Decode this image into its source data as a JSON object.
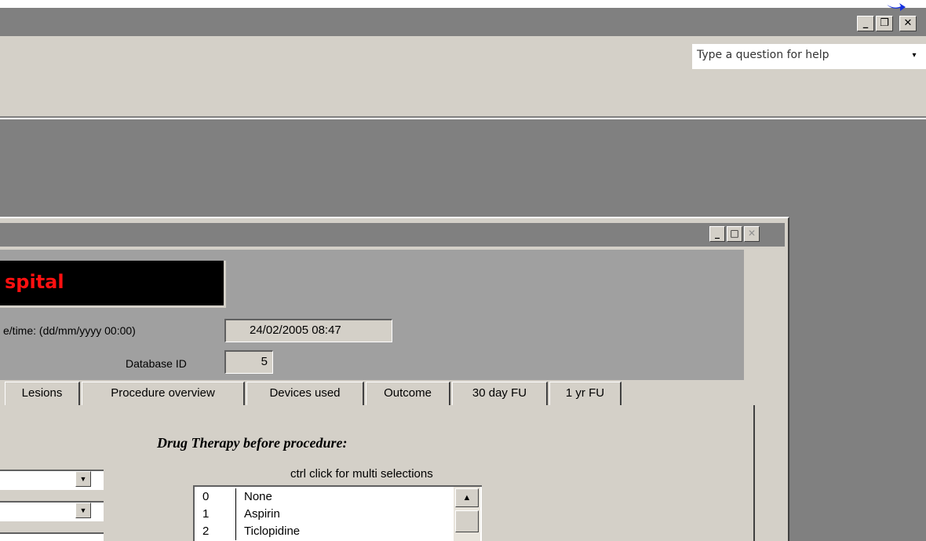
{
  "app": {
    "window_controls": {
      "minimize": "_",
      "restore": "❐",
      "close": "✕"
    },
    "help_placeholder": "Type a question for help",
    "help_dropdown": "▾"
  },
  "form": {
    "window_controls": {
      "minimize": "_",
      "maximize": "□",
      "close": "✕"
    },
    "banner_text": "spital",
    "datetime_label": "e/time: (dd/mm/yyyy 00:00)",
    "datetime_value": "24/02/2005 08:47",
    "database_id_label": "Database ID",
    "database_id_value": "5",
    "tabs": [
      {
        "label": "Lesions"
      },
      {
        "label": "Procedure overview"
      },
      {
        "label": "Devices used"
      },
      {
        "label": "Outcome"
      },
      {
        "label": "30 day FU"
      },
      {
        "label": "1 yr FU"
      }
    ],
    "drug_heading": "Drug Therapy before procedure:",
    "multi_select_hint": "ctrl click for multi selections",
    "drug_list": [
      {
        "code": "0",
        "name": "None"
      },
      {
        "code": "1",
        "name": "Aspirin"
      },
      {
        "code": "2",
        "name": "Ticlopidine"
      }
    ],
    "combo_arrow": "▼",
    "scroll_up": "▲"
  },
  "colors": {
    "banner_text": "#ff1010",
    "banner_bg": "#000000",
    "face": "#d4d0c8",
    "mdi_bg": "#808080"
  }
}
